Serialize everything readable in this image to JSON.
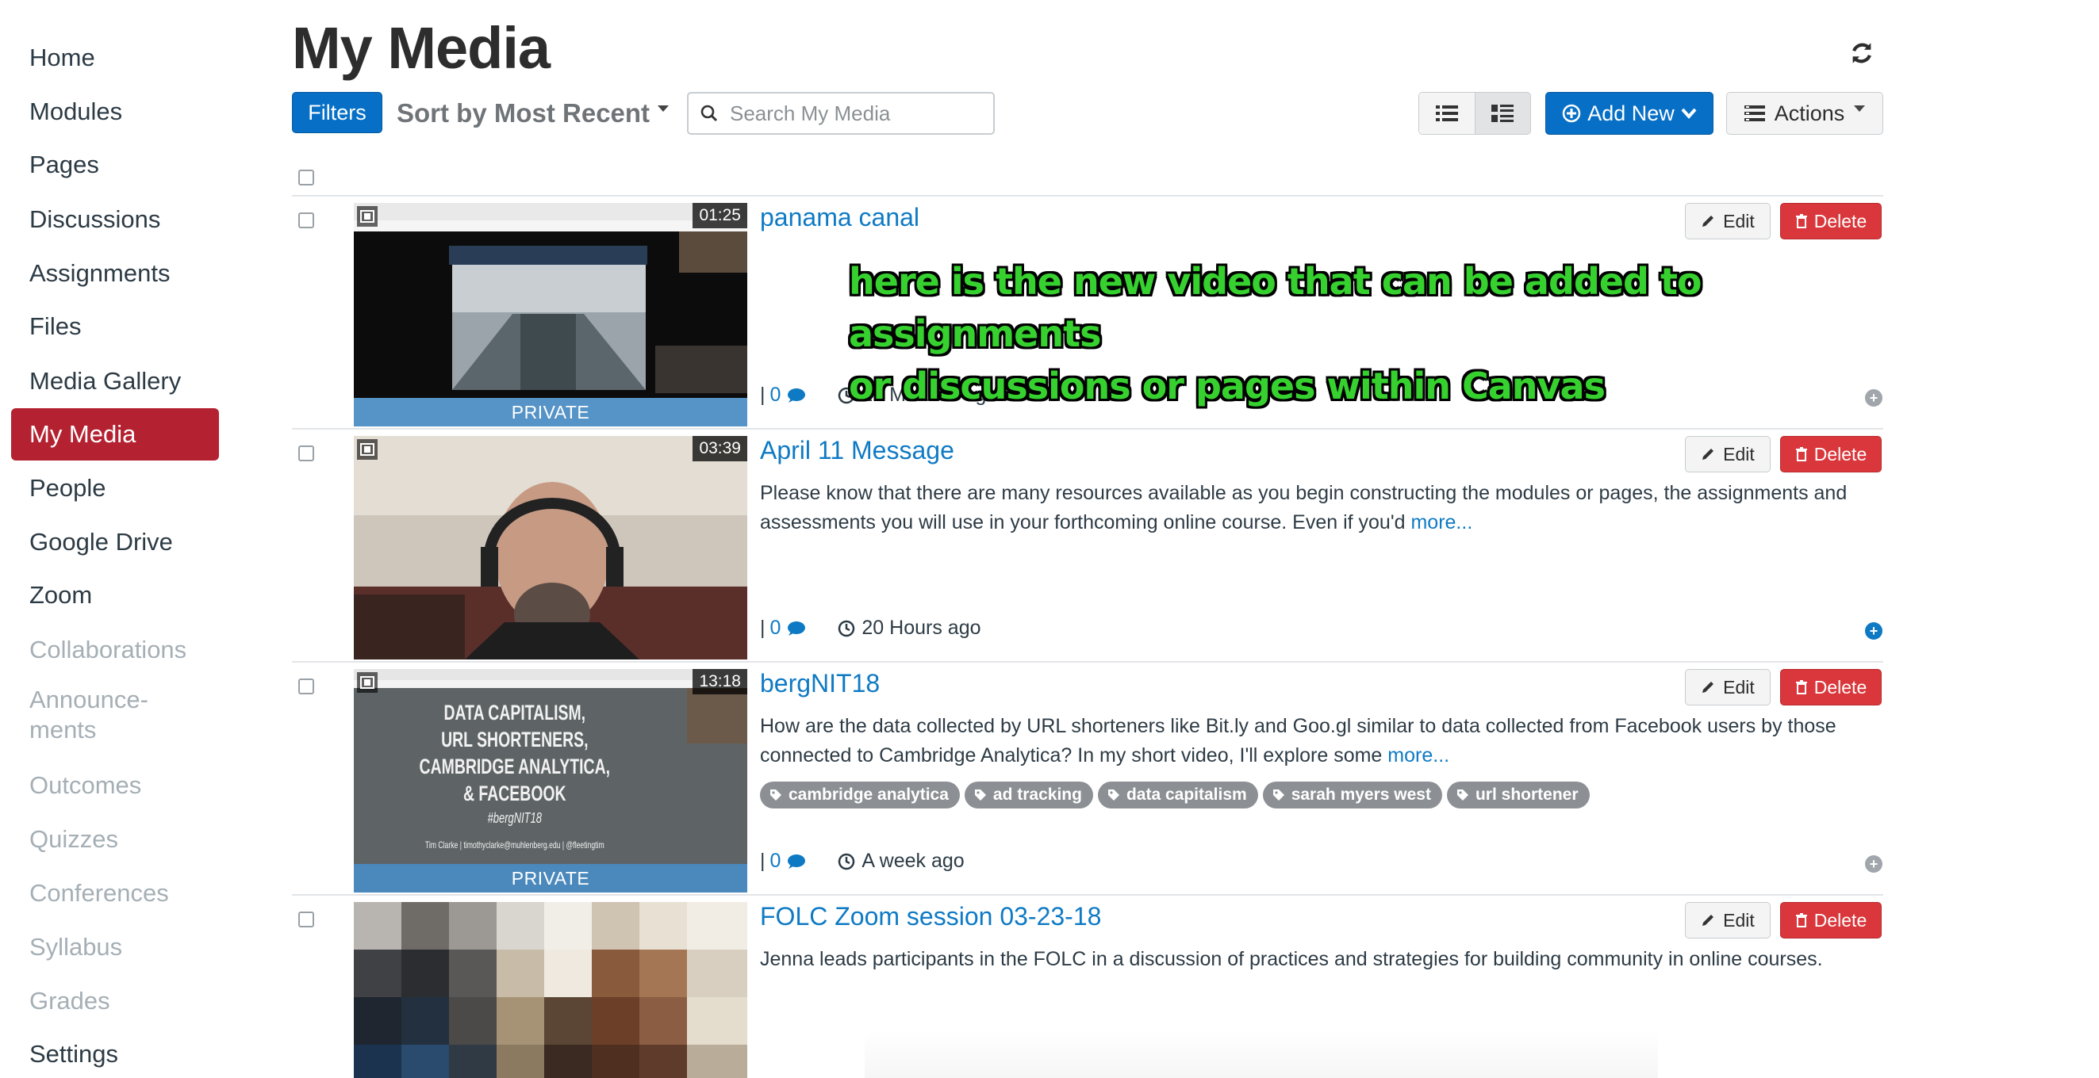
{
  "sidebar": {
    "items": [
      {
        "label": "Home",
        "state": "enabled"
      },
      {
        "label": "Modules",
        "state": "enabled"
      },
      {
        "label": "Pages",
        "state": "enabled"
      },
      {
        "label": "Discussions",
        "state": "enabled"
      },
      {
        "label": "Assignments",
        "state": "enabled"
      },
      {
        "label": "Files",
        "state": "enabled"
      },
      {
        "label": "Media Gallery",
        "state": "enabled"
      },
      {
        "label": "My Media",
        "state": "active"
      },
      {
        "label": "People",
        "state": "enabled"
      },
      {
        "label": "Google Drive",
        "state": "enabled"
      },
      {
        "label": "Zoom",
        "state": "enabled"
      },
      {
        "label": "Collaborations",
        "state": "disabled"
      },
      {
        "label": "Announce-",
        "label2": "ments",
        "state": "disabled"
      },
      {
        "label": "Outcomes",
        "state": "disabled"
      },
      {
        "label": "Quizzes",
        "state": "disabled"
      },
      {
        "label": "Conferences",
        "state": "disabled"
      },
      {
        "label": "Syllabus",
        "state": "disabled"
      },
      {
        "label": "Grades",
        "state": "disabled"
      },
      {
        "label": "Settings",
        "state": "enabled"
      }
    ]
  },
  "header": {
    "title": "My Media",
    "filters_label": "Filters",
    "sort_label": "Sort by Most Recent",
    "search_placeholder": "Search My Media",
    "add_new_label": "Add New",
    "actions_label": "Actions"
  },
  "annotation": {
    "line1": "here is the new video that can be added to assignments",
    "line2": "or discussions or pages within Canvas"
  },
  "media": [
    {
      "title": "panama canal",
      "duration": "01:25",
      "private_label": "PRIVATE",
      "description": "",
      "more_label": "",
      "comments": "0",
      "time": "15 Minutes ago",
      "tags": [],
      "edit_label": "Edit",
      "delete_label": "Delete"
    },
    {
      "title": "April 11 Message",
      "duration": "03:39",
      "private_label": "",
      "description": "Please know that there are many resources available as you begin constructing the modules or pages, the assignments and assessments you will use in your forthcoming online course. Even if you'd",
      "more_label": "more...",
      "comments": "0",
      "time": "20 Hours ago",
      "tags": [],
      "edit_label": "Edit",
      "delete_label": "Delete"
    },
    {
      "title": "bergNIT18",
      "duration": "13:18",
      "private_label": "PRIVATE",
      "description": "How are the data collected by URL shorteners like Bit.ly and Goo.gl similar to data collected from Facebook users by those connected to Cambridge Analytica? In my short video, I'll explore some",
      "more_label": "more...",
      "comments": "0",
      "time": "A week ago",
      "tags": [
        "cambridge analytica",
        "ad tracking",
        "data capitalism",
        "sarah myers west",
        "url shortener"
      ],
      "thumb_text": [
        "DATA CAPITALISM,",
        "URL SHORTENERS,",
        "CAMBRIDGE ANALYTICA,",
        "& FACEBOOK",
        "#bergNIT18",
        "Tim Clarke | timothyclarke@muhlenberg.edu | @fleetingtim"
      ],
      "edit_label": "Edit",
      "delete_label": "Delete"
    },
    {
      "title": "FOLC Zoom session 03-23-18",
      "duration": "",
      "private_label": "",
      "description": "Jenna leads participants in the FOLC in a discussion of practices and strategies for building community in online courses.",
      "more_label": "",
      "comments": "",
      "time": "",
      "tags": [],
      "edit_label": "Edit",
      "delete_label": "Delete"
    }
  ],
  "colors": {
    "accent": "#0770c6",
    "active_nav": "#b42131",
    "danger": "#d9373b",
    "link": "#0e7ac4",
    "annotation": "#36d12f"
  }
}
